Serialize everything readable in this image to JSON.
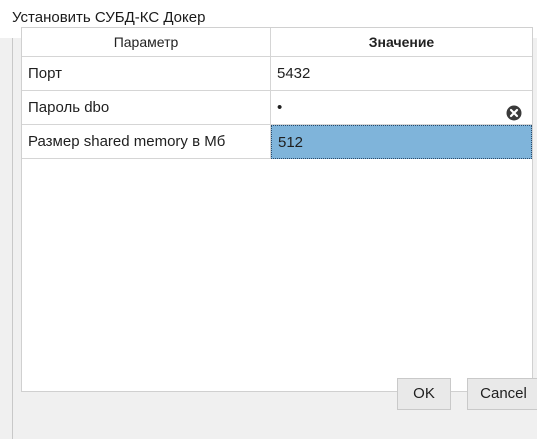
{
  "window": {
    "title": "Установить СУБД-КС Докер"
  },
  "table": {
    "columns": [
      "Параметр",
      "Значение"
    ],
    "rows": [
      {
        "param": "Порт",
        "value": "5432"
      },
      {
        "param": "Пароль dbo",
        "value": "•"
      },
      {
        "param": "Размер shared memory в Мб",
        "value": "512"
      }
    ],
    "selected_row": 2,
    "selection_color": "#7fb4da"
  },
  "buttons": {
    "ok": "OK",
    "cancel": "Cancel"
  },
  "icons": {
    "clear_password": "clear-icon"
  }
}
